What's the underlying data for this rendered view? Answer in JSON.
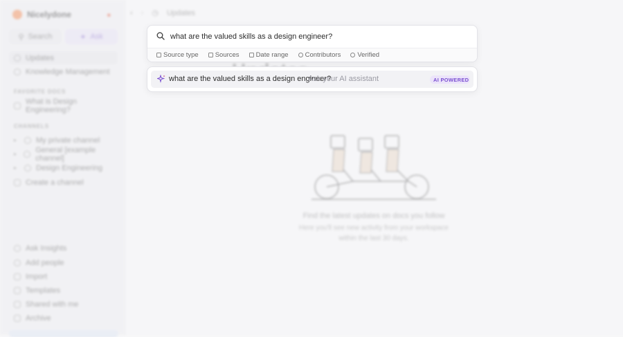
{
  "workspace": {
    "name": "Nicelydone"
  },
  "sidebar": {
    "search_label": "Search",
    "ask_label": "Ask",
    "main_items": [
      {
        "label": "Updates",
        "icon": "clock-icon"
      },
      {
        "label": "Knowledge Management",
        "icon": "globe-icon"
      }
    ],
    "favorites_label": "FAVORITE DOCS",
    "favorites": [
      {
        "label": "What is Design Engineering?",
        "icon": "doc-icon"
      }
    ],
    "channels_label": "CHANNELS",
    "channels": [
      {
        "label": "My private channel",
        "icon": "lock-icon"
      },
      {
        "label": "General [example channel]",
        "icon": "globe-icon"
      },
      {
        "label": "Design Engineering",
        "icon": "lock-icon"
      }
    ],
    "create_channel_label": "Create a channel",
    "bottom_items": [
      {
        "label": "Ask Insights",
        "icon": "insights-icon"
      },
      {
        "label": "Add people",
        "icon": "person-icon"
      },
      {
        "label": "Import",
        "icon": "import-icon"
      },
      {
        "label": "Templates",
        "icon": "template-icon"
      },
      {
        "label": "Shared with me",
        "icon": "shared-icon"
      },
      {
        "label": "Archive",
        "icon": "archive-icon"
      }
    ]
  },
  "topbar": {
    "breadcrumb": "Updates"
  },
  "main": {
    "title": "Updates",
    "empty_heading": "Find the latest updates on docs you follow",
    "empty_body": "Here you'll see new activity from your workspace within the last 30 days."
  },
  "search": {
    "query": "what are the valued skills as a design engineer?",
    "filters": [
      {
        "label": "Source type",
        "icon": "tag-icon"
      },
      {
        "label": "Sources",
        "icon": "doc-icon"
      },
      {
        "label": "Date range",
        "icon": "calendar-icon"
      },
      {
        "label": "Contributors",
        "icon": "person-icon"
      },
      {
        "label": "Verified",
        "icon": "check-circle-icon"
      }
    ]
  },
  "suggestion": {
    "query": "what are the valued skills as a design engineer?",
    "hint": "Ask your AI assistant",
    "badge": "AI POWERED"
  },
  "colors": {
    "accent": "#7a4fd1",
    "brand": "#f07a3a"
  }
}
